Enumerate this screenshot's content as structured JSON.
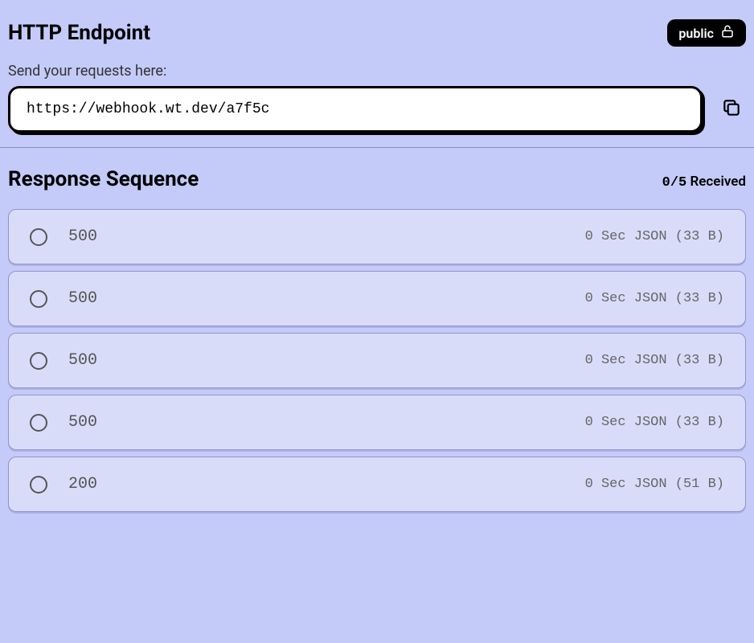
{
  "header": {
    "title": "HTTP Endpoint",
    "badge_label": "public",
    "subtitle": "Send your requests here:",
    "url": "https://webhook.wt.dev/a7f5c"
  },
  "sequence": {
    "title": "Response Sequence",
    "received_count": "0/5",
    "received_label": "Received",
    "items": [
      {
        "status": "500",
        "meta": "0 Sec JSON (33 B)"
      },
      {
        "status": "500",
        "meta": "0 Sec JSON (33 B)"
      },
      {
        "status": "500",
        "meta": "0 Sec JSON (33 B)"
      },
      {
        "status": "500",
        "meta": "0 Sec JSON (33 B)"
      },
      {
        "status": "200",
        "meta": "0 Sec JSON (51 B)"
      }
    ]
  }
}
